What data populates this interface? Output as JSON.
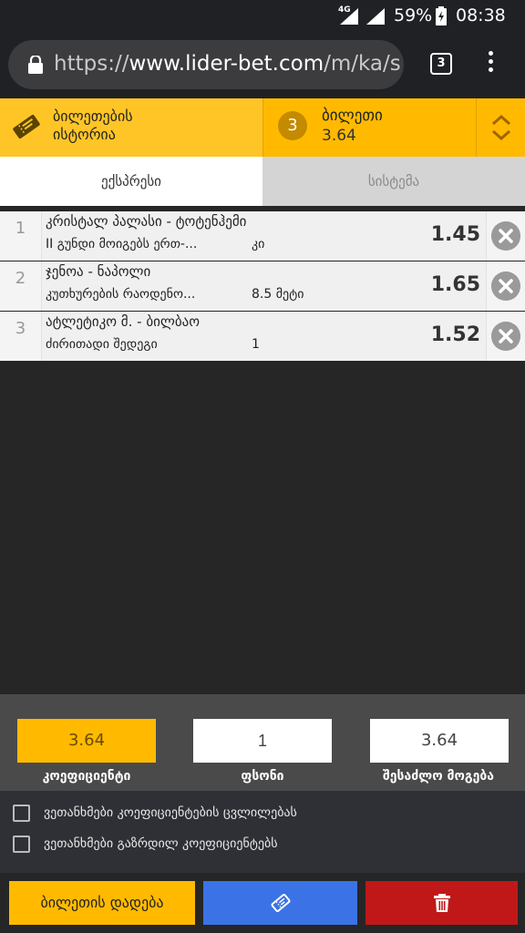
{
  "status_bar": {
    "network": "4G",
    "battery": "59%",
    "time": "08:38"
  },
  "browser": {
    "url_scheme": "https://",
    "url_host": "www.lider-bet.com",
    "url_path": "/m/ka/s",
    "tab_count": "3"
  },
  "header": {
    "history_label_line1": "ბილეთების",
    "history_label_line2": "ისტორია",
    "ticket_count": "3",
    "ticket_title": "ბილეთი",
    "ticket_odd": "3.64"
  },
  "mode_tabs": {
    "express": "ექსპრესი",
    "system": "სისტემა"
  },
  "bets": [
    {
      "num": "1",
      "match": "კრისტალ პალასი - ტოტენჰემი",
      "market": "II გუნდი მოიგებს ერთ-...",
      "outcome": "კი",
      "odd": "1.45"
    },
    {
      "num": "2",
      "match": "ჯენოა - ნაპოლი",
      "market": "კუთხურების რაოდენო...",
      "outcome": "8.5 მეტი",
      "odd": "1.65"
    },
    {
      "num": "3",
      "match": "ატლეტიკო მ. - ბილბაო",
      "market": "ძირითადი შედეგი",
      "outcome": "1",
      "odd": "1.52"
    }
  ],
  "stake": {
    "odds_value": "3.64",
    "odds_label": "კოეფიციენტი",
    "amount_value": "1",
    "amount_label": "ფსონი",
    "win_value": "3.64",
    "win_label": "შესაძლო მოგება"
  },
  "agreements": {
    "odds_change": "ვეთანხმები კოეფიციენტების ცვლილებას",
    "boosted_odds": "ვეთანხმები გაზრდილ კოეფიციენტებს"
  },
  "actions": {
    "place_bet": "ბილეთის დადება"
  },
  "colors": {
    "accent": "#ffba00",
    "blue": "#3b73e6",
    "red": "#c01818"
  }
}
